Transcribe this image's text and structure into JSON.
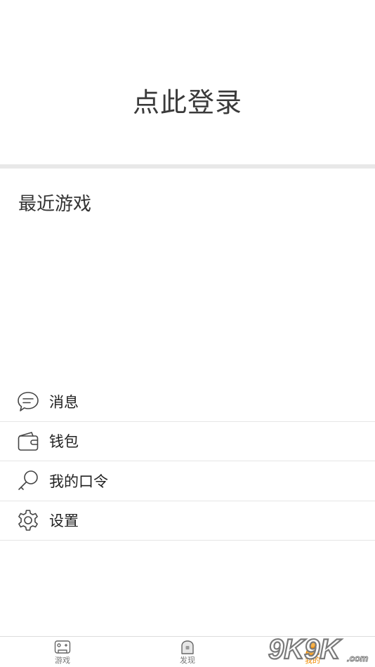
{
  "header": {
    "login_label": "点此登录"
  },
  "recent": {
    "title": "最近游戏"
  },
  "menu": {
    "items": [
      {
        "label": "消息",
        "icon": "chat-bubble-icon"
      },
      {
        "label": "钱包",
        "icon": "wallet-icon"
      },
      {
        "label": "我的口令",
        "icon": "key-icon"
      },
      {
        "label": "设置",
        "icon": "gear-icon"
      }
    ]
  },
  "tabbar": {
    "tabs": [
      {
        "label": "游戏",
        "icon": "gamepad-icon",
        "active": false
      },
      {
        "label": "发现",
        "icon": "discover-icon",
        "active": false
      },
      {
        "label": "我的",
        "icon": "user-icon",
        "active": true
      }
    ]
  },
  "watermark": {
    "text": "9K9K.com"
  },
  "colors": {
    "accent": "#f08a00",
    "divider": "#e8e8e8",
    "text": "#333333"
  }
}
